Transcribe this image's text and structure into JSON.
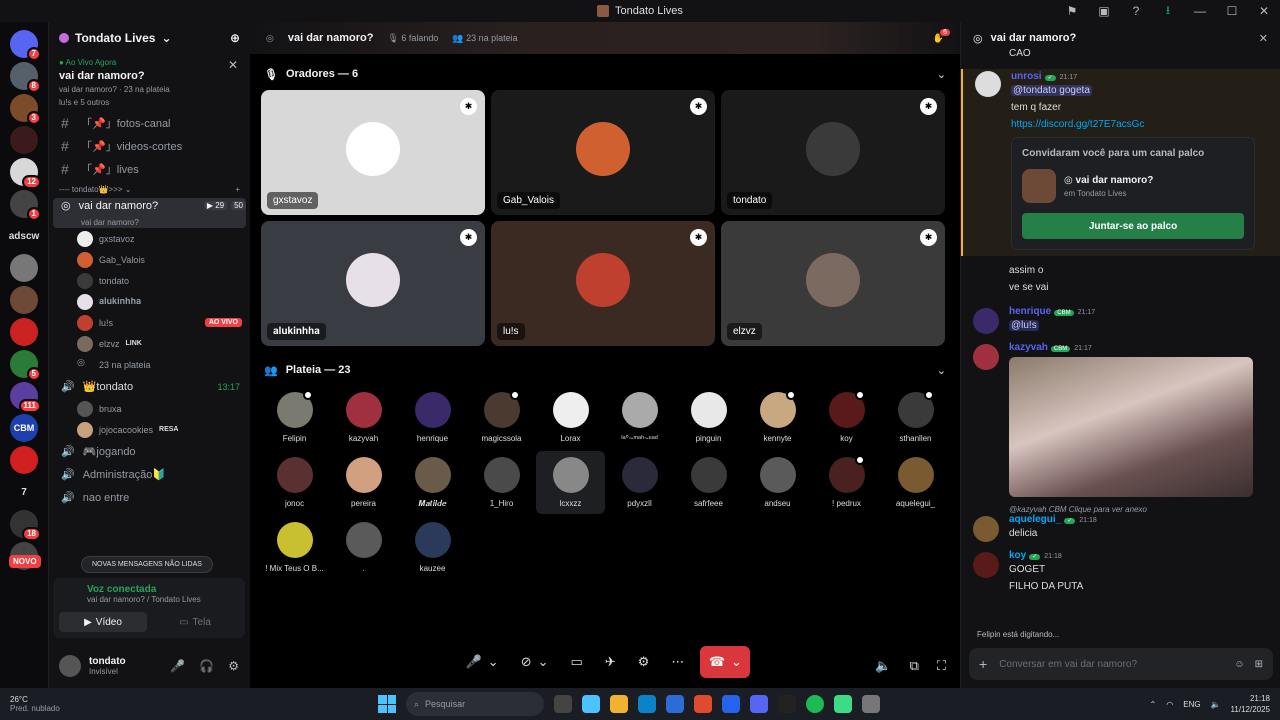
{
  "window": {
    "title": "Tondato Lives"
  },
  "servers": [
    {
      "label": "",
      "badge": "7",
      "color": "#5865f2"
    },
    {
      "label": "",
      "badge": "8",
      "color": "#55606b"
    },
    {
      "label": "",
      "badge": "3",
      "color": "#7b4b2a"
    },
    {
      "label": "",
      "badge": "",
      "color": "#3a1a1a"
    },
    {
      "label": "",
      "badge": "12",
      "color": "#d8d8d8"
    },
    {
      "label": "",
      "badge": "1",
      "color": "#444"
    },
    {
      "label": "adscw",
      "badge": "",
      "color": "transparent"
    },
    {
      "label": "",
      "badge": "",
      "color": "#777"
    },
    {
      "label": "",
      "badge": "",
      "color": "#6d4a38"
    },
    {
      "label": "",
      "badge": "",
      "color": "#c22"
    },
    {
      "label": "",
      "badge": "5",
      "color": "#2a7a3a"
    },
    {
      "label": "",
      "badge": "111",
      "color": "#5a3ea0"
    },
    {
      "label": "CBM",
      "badge": "",
      "color": "#1e40af"
    },
    {
      "label": "",
      "badge": "",
      "color": "#d02020"
    },
    {
      "label": "7",
      "badge": "",
      "color": "transparent"
    },
    {
      "label": "",
      "badge": "18",
      "color": "#333"
    },
    {
      "label": "",
      "badge": "",
      "color": "#444"
    }
  ],
  "novo": "NOVO",
  "server": {
    "name": "Tondato Lives"
  },
  "live": {
    "label": "Ao Vivo Agora",
    "name": "vai dar namoro?",
    "sub1": "vai dar namoro?",
    "sub2": "23 na plateia",
    "sub3": "lu!s e 5 outros"
  },
  "channels": [
    {
      "name": "「📌」fotos-canal"
    },
    {
      "name": "「📌」videos-cortes"
    },
    {
      "name": "「📌」lives"
    }
  ],
  "category": "---- tondato👑>>> ⌄",
  "stage_channel": {
    "name": "vai dar namoro?",
    "sub": "vai dar namoro?",
    "count1": "29",
    "count2": "50"
  },
  "stage_users": [
    {
      "name": "gxstavoz",
      "tag": ""
    },
    {
      "name": "Gab_Valois",
      "tag": ""
    },
    {
      "name": "tondato",
      "tag": ""
    },
    {
      "name": "𝐚𝐥𝐮𝐤𝐢𝐧𝐡𝐡𝐚",
      "tag": ""
    },
    {
      "name": "lu!s",
      "tag": "AO VIVO"
    },
    {
      "name": "elzvz",
      "tag": "LINK"
    },
    {
      "name": "23 na plateia",
      "tag": ""
    }
  ],
  "voice_channel": {
    "name": "👑tondato",
    "time": "13:17"
  },
  "voice_users": [
    {
      "name": "bruxa"
    },
    {
      "name": "jojocacookies",
      "tag": "RESA"
    }
  ],
  "more_channels": [
    {
      "name": "🎮jogando"
    },
    {
      "name": "Administração🔰"
    },
    {
      "name": "nao entre"
    }
  ],
  "new_messages": "NOVAS MENSAGENS NÃO LIDAS",
  "voice": {
    "status": "Voz conectada",
    "channel": "vai dar namoro? / Tondato Lives",
    "video": "Vídeo",
    "screen": "Tela"
  },
  "me": {
    "name": "tondato",
    "status": "Invisível"
  },
  "stage": {
    "title": "vai dar namoro?",
    "speaking": "6 falando",
    "audience": "23 na plateia",
    "badge": "6"
  },
  "speakers_header": "Oradores — 6",
  "speakers": [
    {
      "name": "gxstavoz",
      "bg": "#d8d8d8",
      "av": "#fff"
    },
    {
      "name": "Gab_Valois",
      "bg": "#1a1a1a",
      "av": "#d06030"
    },
    {
      "name": "tondato",
      "bg": "#1a1a1a",
      "av": "#3a3a3a"
    },
    {
      "name": "𝐚𝐥𝐮𝐤𝐢𝐧𝐡𝐡𝐚",
      "bg": "#3a3c43",
      "av": "#e8e0e8"
    },
    {
      "name": "lu!s",
      "bg": "#3a2a22",
      "av": "#c04030"
    },
    {
      "name": "elzvz",
      "bg": "#3a3a3a",
      "av": "#7a6a60"
    }
  ],
  "audience_header": "Plateia — 23",
  "audience": [
    {
      "name": "Felipin",
      "color": "#7a7a70",
      "mark": true
    },
    {
      "name": "kazyvah",
      "color": "#a03040",
      "mark": false
    },
    {
      "name": "henrique",
      "color": "#3a2a6a",
      "mark": false
    },
    {
      "name": "magicssola",
      "color": "#4a3a30",
      "mark": true
    },
    {
      "name": "Lorax",
      "color": "#eeeeee",
      "mark": false
    },
    {
      "name": "ᴵᵃ°~ᵐᵃʰ~ᵉᵃᵈ",
      "color": "#aaaaaa",
      "mark": false
    },
    {
      "name": "pinguin",
      "color": "#e8e8e8",
      "mark": false
    },
    {
      "name": "kennyte",
      "color": "#c8a880",
      "mark": true
    },
    {
      "name": "koy",
      "color": "#5a1a1a",
      "mark": true
    },
    {
      "name": "sthanllen",
      "color": "#3a3a3a",
      "mark": true
    },
    {
      "name": "jonoc",
      "color": "#5a3030",
      "mark": false
    },
    {
      "name": "pereira",
      "color": "#d0a080",
      "mark": false
    },
    {
      "name": "𝑴𝒂𝒕𝒊𝒍𝒅𝒆",
      "color": "#6a5a4a",
      "mark": false
    },
    {
      "name": "1_Hiro",
      "color": "#4a4a4a",
      "mark": false
    },
    {
      "name": "lcxxzz",
      "color": "#888888",
      "mark": false
    },
    {
      "name": "pdyxzll",
      "color": "#2a2a3a",
      "mark": false
    },
    {
      "name": "safrfeee",
      "color": "#3a3a3a",
      "mark": false
    },
    {
      "name": "andseu",
      "color": "#5a5a5a",
      "mark": false
    },
    {
      "name": "! pedrux",
      "color": "#4a2020",
      "mark": true
    },
    {
      "name": "aquelegui_",
      "color": "#7a5a30",
      "mark": false
    },
    {
      "name": "! Mix Teus O B...",
      "color": "#c8c030",
      "mark": false
    },
    {
      "name": ".",
      "color": "#5a5a5a",
      "mark": false
    },
    {
      "name": "kauzee",
      "color": "#2a3a5a",
      "mark": false
    }
  ],
  "chat": {
    "title": "vai dar namoro?",
    "top_text": "CAO",
    "messages": [
      {
        "author": "unrosi",
        "color": "#5865f2",
        "time": "21:17",
        "lines": [
          "@tondato gogeta",
          "tem q fazer",
          "https://discord.gg/t27E7acsGc"
        ]
      },
      {
        "author": "henrique",
        "color": "#5865f2",
        "time": "21:17",
        "lines": [
          "@lu!s"
        ]
      },
      {
        "author": "kazyvah",
        "color": "#5865f2",
        "time": "21:17",
        "lines": []
      },
      {
        "author": "aquelegui_",
        "color": "#00a8fc",
        "time": "21:18",
        "lines": [
          "delicia"
        ]
      },
      {
        "author": "koy",
        "color": "#00a8fc",
        "time": "21:18",
        "lines": [
          "GOGET",
          "FILHO DA PUTA"
        ]
      }
    ],
    "plain": [
      "assim o",
      "ve se vai"
    ],
    "invite": {
      "title": "Convidaram você para um canal palco",
      "name": "vai dar namoro?",
      "sub": "em Tondato Lives",
      "button": "Juntar-se ao palco"
    },
    "reply": "@kazyvah  CBM  Clique para ver anexo",
    "typing": "Felipin está digitando...",
    "placeholder": "Conversar em vai dar namoro?",
    "cbm": "CBM"
  },
  "taskbar": {
    "temp": "26°C",
    "weather": "Pred. nublado",
    "search": "Pesquisar",
    "lang": "ENG",
    "time": "21:18",
    "date": "11/12/2025"
  }
}
